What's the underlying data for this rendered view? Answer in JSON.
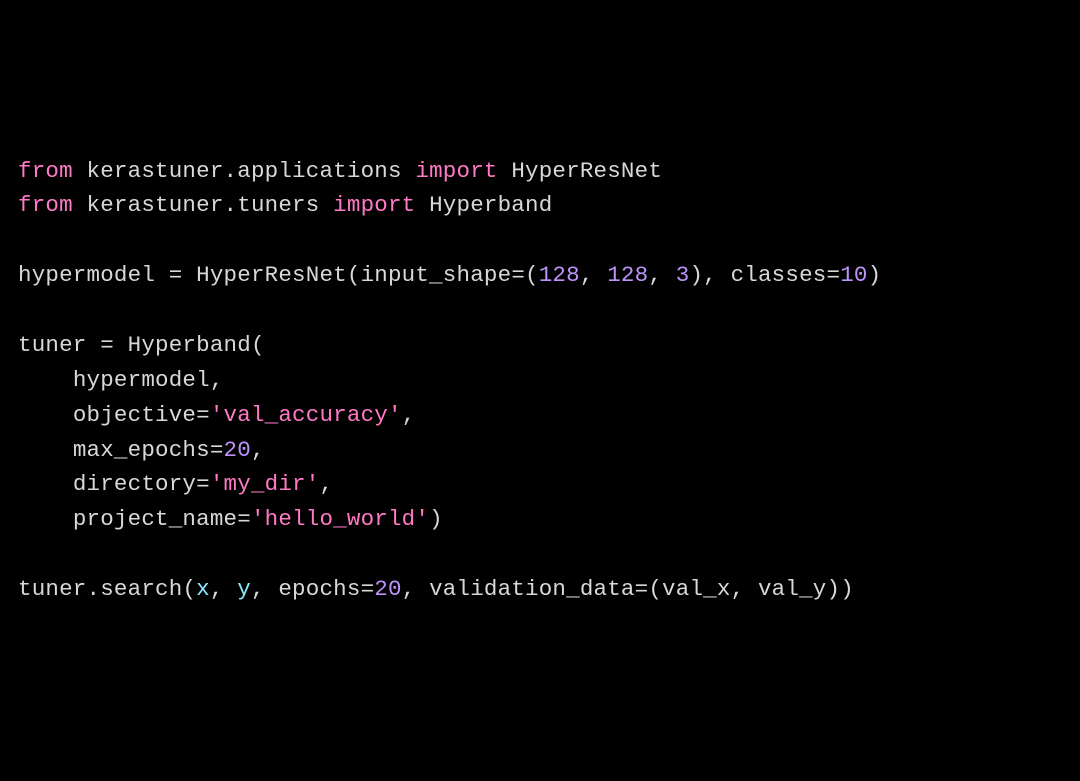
{
  "code": {
    "tokens": [
      {
        "t": "from",
        "c": "kw"
      },
      {
        "t": " "
      },
      {
        "t": "kerastuner"
      },
      {
        "t": "."
      },
      {
        "t": "applications"
      },
      {
        "t": " "
      },
      {
        "t": "import",
        "c": "kw"
      },
      {
        "t": " "
      },
      {
        "t": "HyperResNet"
      },
      {
        "t": "\n"
      },
      {
        "t": "from",
        "c": "kw"
      },
      {
        "t": " "
      },
      {
        "t": "kerastuner"
      },
      {
        "t": "."
      },
      {
        "t": "tuners"
      },
      {
        "t": " "
      },
      {
        "t": "import",
        "c": "kw"
      },
      {
        "t": " "
      },
      {
        "t": "Hyperband"
      },
      {
        "t": "\n"
      },
      {
        "t": "\n"
      },
      {
        "t": "hypermodel "
      },
      {
        "t": "="
      },
      {
        "t": " "
      },
      {
        "t": "HyperResNet"
      },
      {
        "t": "("
      },
      {
        "t": "input_shape"
      },
      {
        "t": "="
      },
      {
        "t": "("
      },
      {
        "t": "128",
        "c": "num"
      },
      {
        "t": ", "
      },
      {
        "t": "128",
        "c": "num"
      },
      {
        "t": ", "
      },
      {
        "t": "3",
        "c": "num"
      },
      {
        "t": ")"
      },
      {
        "t": ", "
      },
      {
        "t": "classes"
      },
      {
        "t": "="
      },
      {
        "t": "10",
        "c": "num"
      },
      {
        "t": ")"
      },
      {
        "t": "\n"
      },
      {
        "t": "\n"
      },
      {
        "t": "tuner "
      },
      {
        "t": "="
      },
      {
        "t": " "
      },
      {
        "t": "Hyperband"
      },
      {
        "t": "("
      },
      {
        "t": "\n"
      },
      {
        "t": "    "
      },
      {
        "t": "hypermodel"
      },
      {
        "t": ","
      },
      {
        "t": "\n"
      },
      {
        "t": "    "
      },
      {
        "t": "objective"
      },
      {
        "t": "="
      },
      {
        "t": "'val_accuracy'",
        "c": "str"
      },
      {
        "t": ","
      },
      {
        "t": "\n"
      },
      {
        "t": "    "
      },
      {
        "t": "max_epochs"
      },
      {
        "t": "="
      },
      {
        "t": "20",
        "c": "num"
      },
      {
        "t": ","
      },
      {
        "t": "\n"
      },
      {
        "t": "    "
      },
      {
        "t": "directory"
      },
      {
        "t": "="
      },
      {
        "t": "'my_dir'",
        "c": "str"
      },
      {
        "t": ","
      },
      {
        "t": "\n"
      },
      {
        "t": "    "
      },
      {
        "t": "project_name"
      },
      {
        "t": "="
      },
      {
        "t": "'hello_world'",
        "c": "str"
      },
      {
        "t": ")"
      },
      {
        "t": "\n"
      },
      {
        "t": "\n"
      },
      {
        "t": "tuner"
      },
      {
        "t": "."
      },
      {
        "t": "search"
      },
      {
        "t": "("
      },
      {
        "t": "x",
        "c": "builtin"
      },
      {
        "t": ", "
      },
      {
        "t": "y",
        "c": "builtin"
      },
      {
        "t": ", "
      },
      {
        "t": "epochs"
      },
      {
        "t": "="
      },
      {
        "t": "20",
        "c": "num"
      },
      {
        "t": ", "
      },
      {
        "t": "validation_data"
      },
      {
        "t": "="
      },
      {
        "t": "("
      },
      {
        "t": "val_x"
      },
      {
        "t": ", "
      },
      {
        "t": "val_y"
      },
      {
        "t": ")"
      },
      {
        "t": ")"
      },
      {
        "t": "\n"
      }
    ]
  },
  "source_plain": "from kerastuner.applications import HyperResNet\nfrom kerastuner.tuners import Hyperband\n\nhypermodel = HyperResNet(input_shape=(128, 128, 3), classes=10)\n\ntuner = Hyperband(\n    hypermodel,\n    objective='val_accuracy',\n    max_epochs=20,\n    directory='my_dir',\n    project_name='hello_world')\n\ntuner.search(x, y, epochs=20, validation_data=(val_x, val_y))\n"
}
